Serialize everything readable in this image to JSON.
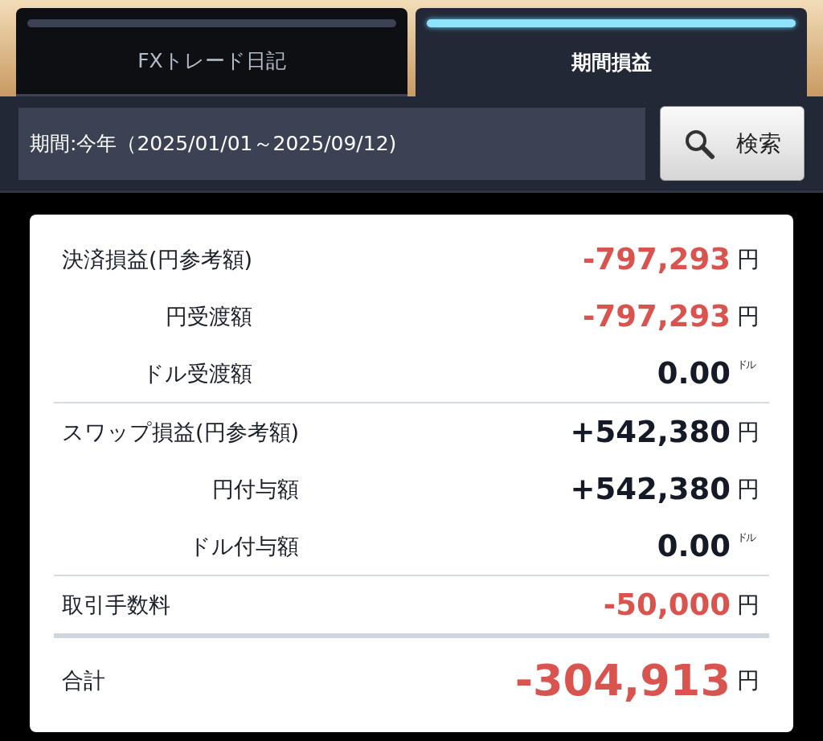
{
  "tabs": [
    {
      "label": "FXトレード日記",
      "selected": false
    },
    {
      "label": "期間損益",
      "selected": true
    }
  ],
  "period": {
    "value": "期間:今年（2025/01/01～2025/09/12)"
  },
  "search_button": {
    "label": "検索"
  },
  "groups": [
    {
      "rows": [
        {
          "kind": "main",
          "label": "決済損益(円参考額)",
          "value": "-797,293",
          "unit": "円",
          "color": "#d9534f"
        },
        {
          "kind": "sub",
          "label": "円受渡額",
          "value": "-797,293",
          "unit": "円",
          "color": "#d9534f"
        },
        {
          "kind": "sub",
          "label": "ドル受渡額",
          "value": "0.00",
          "unit": "ドル",
          "color": "#141a26"
        }
      ]
    },
    {
      "rows": [
        {
          "kind": "main",
          "label": "スワップ損益(円参考額)",
          "value": "+542,380",
          "unit": "円",
          "color": "#141a26"
        },
        {
          "kind": "sub",
          "label": "円付与額",
          "value": "+542,380",
          "unit": "円",
          "color": "#141a26"
        },
        {
          "kind": "sub",
          "label": "ドル付与額",
          "value": "0.00",
          "unit": "ドル",
          "color": "#141a26"
        }
      ]
    },
    {
      "rows": [
        {
          "kind": "main",
          "label": "取引手数料",
          "value": "-50,000",
          "unit": "円",
          "color": "#d9534f"
        }
      ]
    }
  ],
  "total": {
    "label": "合計",
    "value": "-304,913",
    "unit": "円",
    "color": "#d9534f"
  }
}
